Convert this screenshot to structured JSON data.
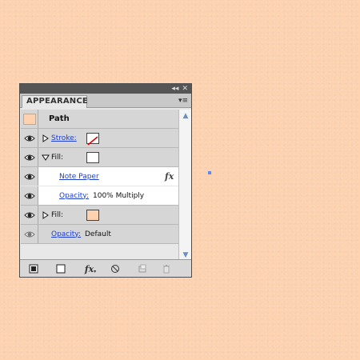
{
  "panel": {
    "title_controls": {
      "collapse": "◂◂",
      "close": "✕"
    },
    "tab_label": "APPEARANCE",
    "menu_glyph": "▾≡",
    "header_row": {
      "label": "Path"
    },
    "rows": [
      {
        "label": "Stroke:",
        "swatch": "none"
      },
      {
        "label": "Fill:",
        "swatch": "white"
      },
      {
        "label": "Note Paper",
        "fx": "fx"
      },
      {
        "label": "Opacity:",
        "value": "100% Multiply"
      },
      {
        "label": "Fill:",
        "swatch": "peach"
      },
      {
        "label": "Opacity:",
        "value": "Default"
      }
    ],
    "bottom_icons": [
      "stroke-square-icon",
      "fill-square-icon",
      "fx-add-icon",
      "clear-appearance-icon",
      "duplicate-item-icon",
      "delete-item-icon"
    ],
    "fx_text": "fx"
  },
  "colors": {
    "canvas": "#fcd2b1",
    "link": "#1f3fcb",
    "selection": "#5a8bf0"
  }
}
